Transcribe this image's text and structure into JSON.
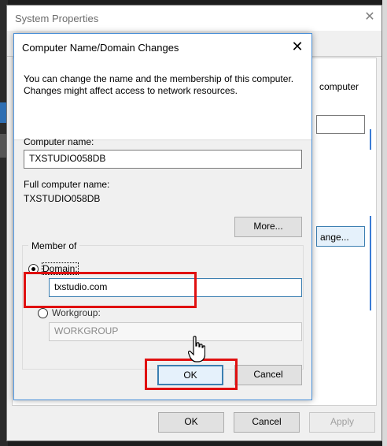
{
  "system_properties": {
    "title": "System Properties",
    "close_glyph": "✕",
    "bg_text_computer": "computer",
    "bg_button_label": "ange...",
    "bottom_buttons": {
      "ok": "OK",
      "cancel": "Cancel",
      "apply": "Apply"
    }
  },
  "dialog": {
    "title": "Computer Name/Domain Changes",
    "close_glyph": "✕",
    "description": "You can change the name and the membership of this computer. Changes might affect access to network resources.",
    "computer_name_label": "Computer name:",
    "computer_name_value": "TXSTUDIO058DB",
    "full_name_label": "Full computer name:",
    "full_name_value": "TXSTUDIO058DB",
    "more_button": "More...",
    "member_of_label": "Member of",
    "domain_label": "Domain:",
    "domain_value": "txstudio.com",
    "domain_selected": true,
    "workgroup_label": "Workgroup:",
    "workgroup_value": "WORKGROUP",
    "ok_button": "OK",
    "cancel_button": "Cancel"
  },
  "colors": {
    "highlight": "#e01010",
    "accent": "#3c7fb1"
  }
}
